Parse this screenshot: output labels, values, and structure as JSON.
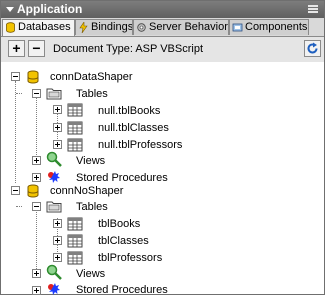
{
  "panel": {
    "title": "Application",
    "tabs": [
      {
        "label": "Databases",
        "icon": "database-icon",
        "active": true
      },
      {
        "label": "Bindings",
        "icon": "bindings-icon",
        "active": false
      },
      {
        "label": "Server Behaviors",
        "icon": "server-behaviors-icon",
        "active": false
      },
      {
        "label": "Components",
        "icon": "components-icon",
        "active": false
      }
    ]
  },
  "toolbar": {
    "add_label": "+",
    "remove_label": "−",
    "document_type": "Document Type: ASP VBScript"
  },
  "tree": {
    "connections": [
      {
        "name": "connDataShaper",
        "tables_label": "Tables",
        "tables": [
          "null.tblBooks",
          "null.tblClasses",
          "null.tblProfessors"
        ],
        "views_label": "Views",
        "stored_procedures_label": "Stored Procedures"
      },
      {
        "name": "connNoShaper",
        "tables_label": "Tables",
        "tables": [
          "tblBooks",
          "tblClasses",
          "tblProfessors"
        ],
        "views_label": "Views",
        "stored_procedures_label": "Stored Procedures"
      }
    ]
  },
  "colors": {
    "titlebar": "#6f6f6f",
    "database_yellow": "#f2c300",
    "views_green": "#2e8b2e",
    "procedures_blue": "#1e3cff",
    "procedures_red": "#e02020"
  }
}
